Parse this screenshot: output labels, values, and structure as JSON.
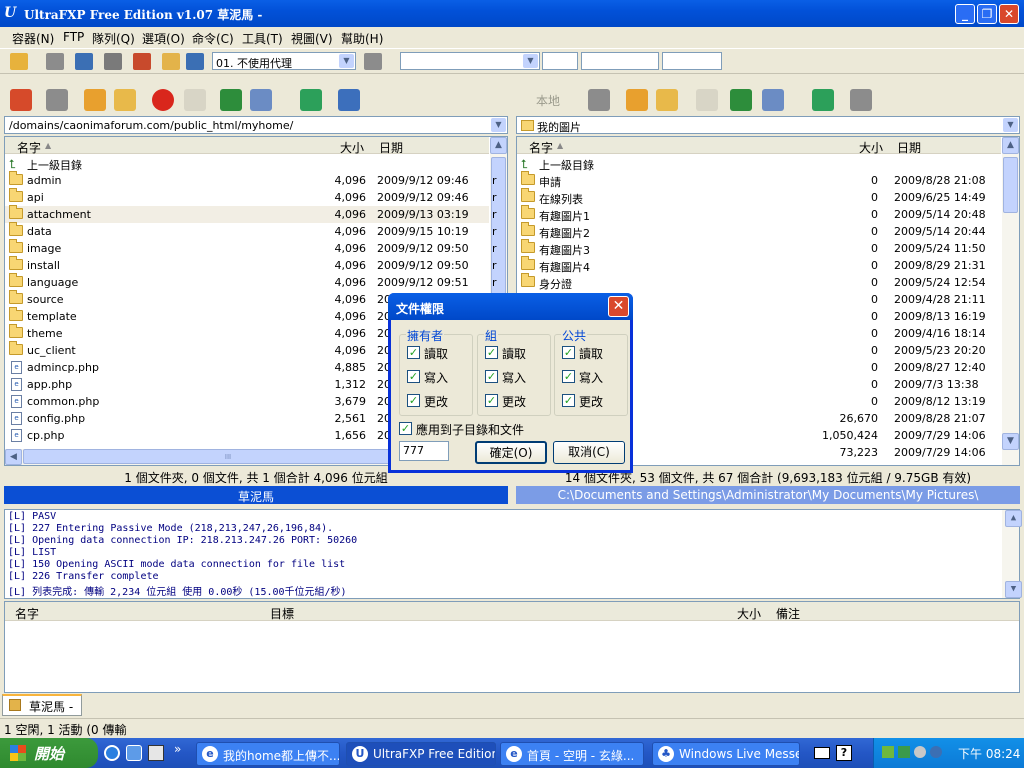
{
  "window": {
    "title": "UltraFXP Free Edition v1.07  草泥馬 -",
    "app_icon": "U"
  },
  "menu": [
    "容器(N)",
    "FTP",
    "隊列(Q)",
    "選項(O)",
    "命令(C)",
    "工具(T)",
    "視圖(V)",
    "幫助(H)"
  ],
  "toolbar": {
    "proxy_value": "01. 不使用代理"
  },
  "left": {
    "path": "/domains/caonimaforum.com/public_html/myhome/",
    "headers": {
      "name": "名字",
      "size": "大小",
      "date": "日期"
    },
    "rows": [
      {
        "icon": "up",
        "name": "上一級目錄",
        "size": "",
        "date": "",
        "extra": ""
      },
      {
        "icon": "folder",
        "name": "admin",
        "size": "4,096",
        "date": "2009/9/12 09:46",
        "extra": "r"
      },
      {
        "icon": "folder",
        "name": "api",
        "size": "4,096",
        "date": "2009/9/12 09:46",
        "extra": "r"
      },
      {
        "icon": "folder",
        "name": "attachment",
        "size": "4,096",
        "date": "2009/9/13 03:19",
        "extra": "r"
      },
      {
        "icon": "folder",
        "name": "data",
        "size": "4,096",
        "date": "2009/9/15 10:19",
        "extra": "r"
      },
      {
        "icon": "folder",
        "name": "image",
        "size": "4,096",
        "date": "2009/9/12 09:50",
        "extra": "r"
      },
      {
        "icon": "folder",
        "name": "install",
        "size": "4,096",
        "date": "2009/9/12 09:50",
        "extra": "r"
      },
      {
        "icon": "folder",
        "name": "language",
        "size": "4,096",
        "date": "2009/9/12 09:51",
        "extra": "r"
      },
      {
        "icon": "folder",
        "name": "source",
        "size": "4,096",
        "date": "20",
        "extra": ""
      },
      {
        "icon": "folder",
        "name": "template",
        "size": "4,096",
        "date": "20",
        "extra": ""
      },
      {
        "icon": "folder",
        "name": "theme",
        "size": "4,096",
        "date": "20",
        "extra": ""
      },
      {
        "icon": "folder",
        "name": "uc_client",
        "size": "4,096",
        "date": "20",
        "extra": ""
      },
      {
        "icon": "file",
        "name": "admincp.php",
        "size": "4,885",
        "date": "20",
        "extra": ""
      },
      {
        "icon": "file",
        "name": "app.php",
        "size": "1,312",
        "date": "20",
        "extra": ""
      },
      {
        "icon": "file",
        "name": "common.php",
        "size": "3,679",
        "date": "20",
        "extra": ""
      },
      {
        "icon": "file",
        "name": "config.php",
        "size": "2,561",
        "date": "20",
        "extra": ""
      },
      {
        "icon": "file",
        "name": "cp.php",
        "size": "1,656",
        "date": "20",
        "extra": ""
      }
    ],
    "selected_index": 3,
    "hscroll_grip": "III",
    "status": "1 個文件夾, 0 個文件, 共 1 個合計 4,096 位元組",
    "site": "草泥馬"
  },
  "right": {
    "local_label": "本地",
    "path": "我的圖片",
    "headers": {
      "name": "名字",
      "size": "大小",
      "date": "日期"
    },
    "rows": [
      {
        "icon": "up",
        "name": "上一級目錄",
        "size": "",
        "date": ""
      },
      {
        "icon": "folder",
        "name": "申請",
        "size": "0",
        "date": "2009/8/28 21:08"
      },
      {
        "icon": "folder",
        "name": "在線列表",
        "size": "0",
        "date": "2009/6/25 14:49"
      },
      {
        "icon": "folder",
        "name": "有趣圖片1",
        "size": "0",
        "date": "2009/5/14 20:48"
      },
      {
        "icon": "folder",
        "name": "有趣圖片2",
        "size": "0",
        "date": "2009/5/14 20:44"
      },
      {
        "icon": "folder",
        "name": "有趣圖片3",
        "size": "0",
        "date": "2009/5/24 11:50"
      },
      {
        "icon": "folder",
        "name": "有趣圖片4",
        "size": "0",
        "date": "2009/8/29 21:31"
      },
      {
        "icon": "folder",
        "name": "身分證",
        "size": "0",
        "date": "2009/5/24 12:54"
      },
      {
        "icon": "",
        "name": "",
        "size": "0",
        "date": "2009/4/28 21:11"
      },
      {
        "icon": "",
        "name": "",
        "size": "0",
        "date": "2009/8/13 16:19"
      },
      {
        "icon": "",
        "name": "",
        "size": "0",
        "date": "2009/4/16 18:14"
      },
      {
        "icon": "",
        "name": "",
        "size": "0",
        "date": "2009/5/23 20:20"
      },
      {
        "icon": "",
        "name": "",
        "size": "0",
        "date": "2009/8/27 12:40"
      },
      {
        "icon": "",
        "name": "",
        "size": "0",
        "date": "2009/7/3 13:38"
      },
      {
        "icon": "",
        "name": "",
        "size": "0",
        "date": "2009/8/12 13:19"
      },
      {
        "icon": "",
        "name": "",
        "size": "26,670",
        "date": "2009/8/28 21:07"
      },
      {
        "icon": "",
        "name": "",
        "size": "1,050,424",
        "date": "2009/7/29 14:06"
      },
      {
        "icon": "",
        "name": "",
        "size": "73,223",
        "date": "2009/7/29 14:06"
      }
    ],
    "status": "14 個文件夾, 53 個文件, 共 67 個合計 (9,693,183 位元組 / 9.75GB 有效)",
    "local_path": "C:\\Documents and Settings\\Administrator\\My Documents\\My Pictures\\"
  },
  "log": [
    "[L] PASV",
    "[L] 227 Entering Passive Mode (218,213,247,26,196,84).",
    "[L] Opening data connection IP: 218.213.247.26 PORT: 50260",
    "[L] LIST",
    "[L] 150 Opening ASCII mode data connection for file list",
    "[L] 226 Transfer complete",
    "[L] 列表完成: 傳輸 2,234 位元組 使用 0.00秒 (15.00千位元組/秒)"
  ],
  "queue": {
    "headers": {
      "name": "名字",
      "target": "目標",
      "size": "大小",
      "note": "備注"
    }
  },
  "tab": {
    "label": "草泥馬 -"
  },
  "statusbar": {
    "text": "1 空閑, 1 活動 (0 傳輸"
  },
  "dialog": {
    "title": "文件權限",
    "groups": [
      {
        "label": "擁有者",
        "items": [
          "讀取",
          "寫入",
          "更改"
        ]
      },
      {
        "label": "組",
        "items": [
          "讀取",
          "寫入",
          "更改"
        ]
      },
      {
        "label": "公共",
        "items": [
          "讀取",
          "寫入",
          "更改"
        ]
      }
    ],
    "recursive_label": "應用到子目錄和文件",
    "mode_value": "777",
    "ok_label": "確定(O)",
    "cancel_label": "取消(C)"
  },
  "taskbar": {
    "start": "開始",
    "tasks": [
      {
        "label": "我的home都上傳不..."
      },
      {
        "label": "UltraFXP Free Edition"
      },
      {
        "label": "首頁 - 空明 - 玄綠..."
      },
      {
        "label": "Windows Live Messe..."
      }
    ],
    "clock": "下午 08:24"
  }
}
